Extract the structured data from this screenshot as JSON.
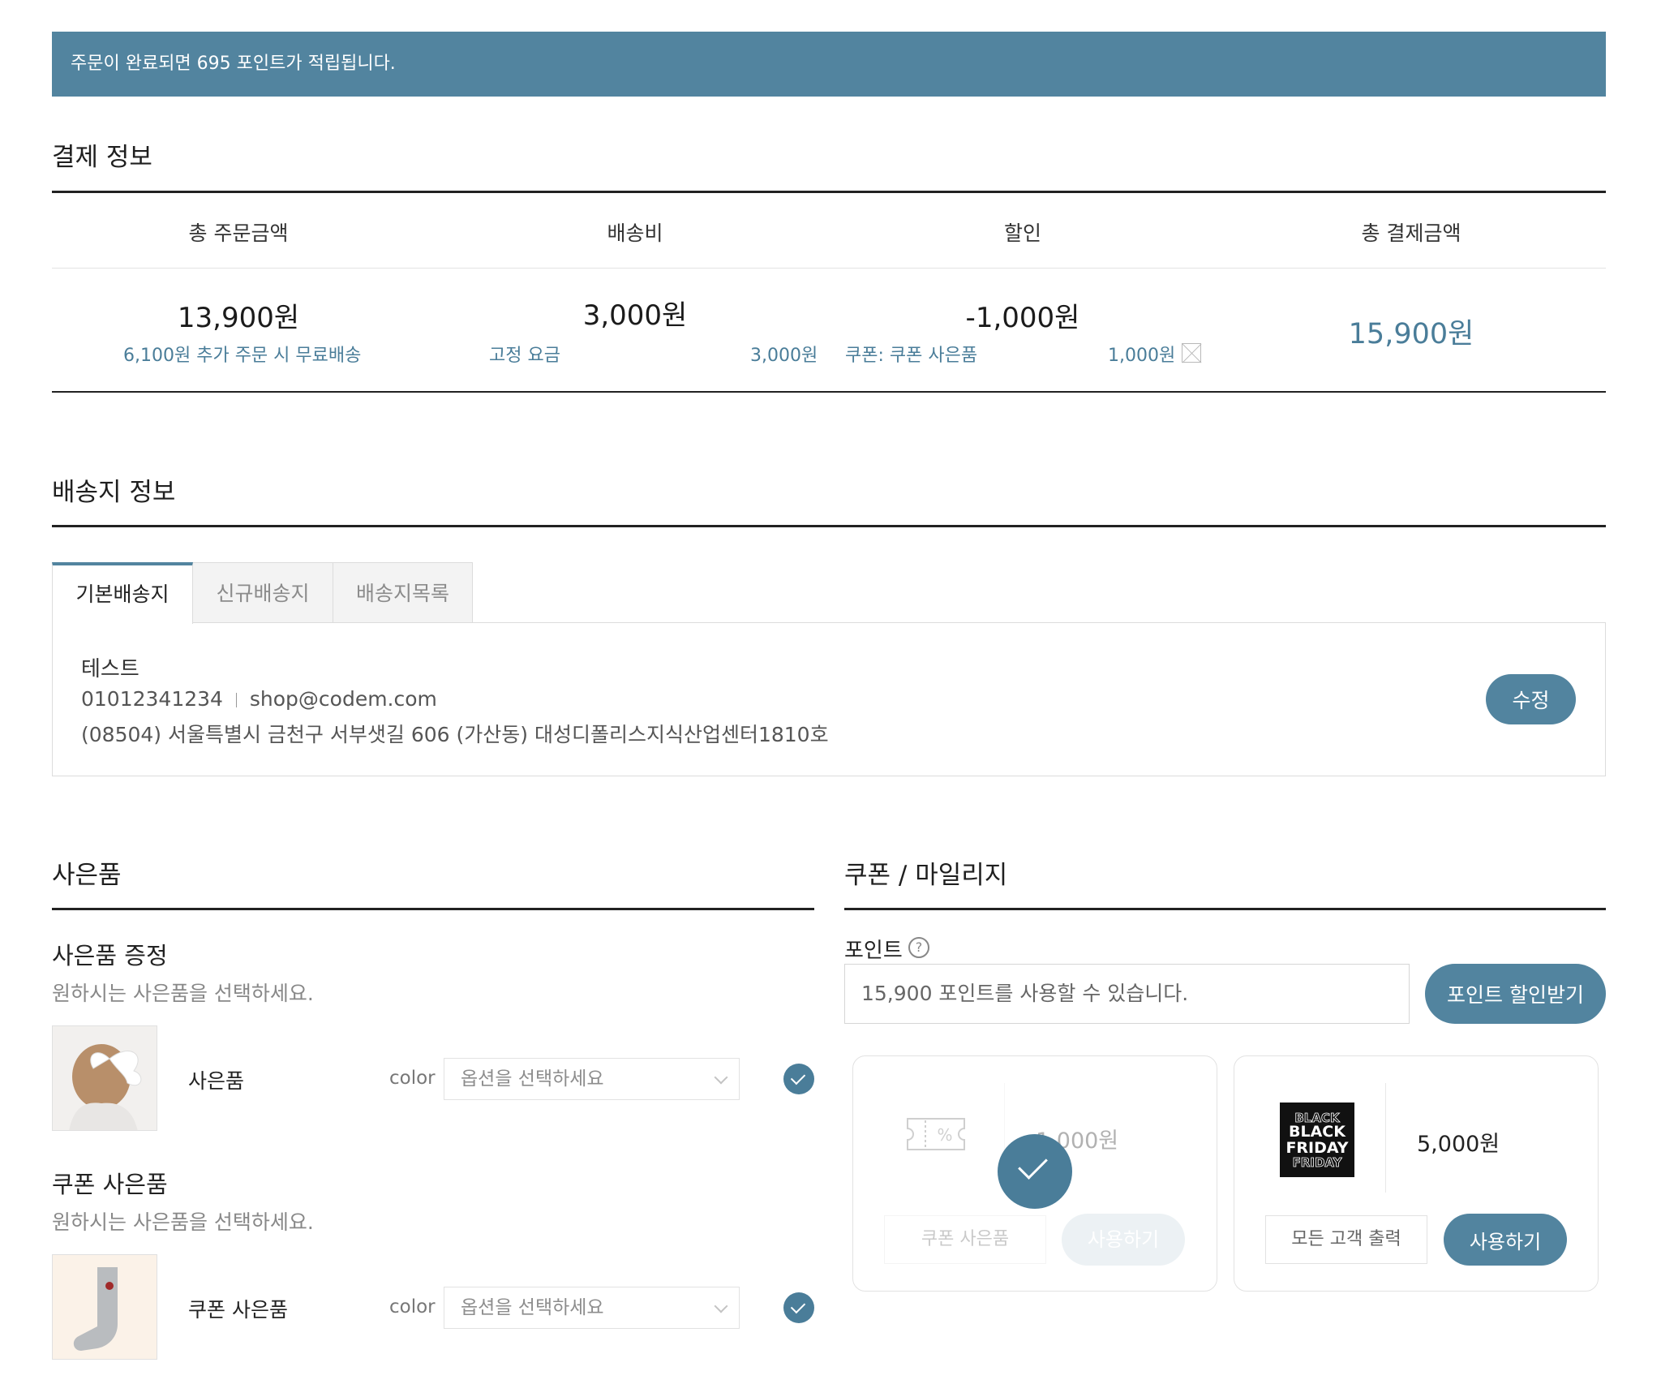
{
  "banner": {
    "text": "주문이 완료되면 695 포인트가 적립됩니다."
  },
  "payment": {
    "title": "결제 정보",
    "headers": [
      "총 주문금액",
      "배송비",
      "할인",
      "총 결제금액"
    ],
    "order_total": "13,900원",
    "order_sub": "6,100원 추가 주문 시 무료배송",
    "shipping": "3,000원",
    "shipping_sub_label": "고정 요금",
    "shipping_sub_value": "3,000원",
    "discount": "-1,000원",
    "discount_sub_label": "쿠폰: 쿠폰 사은품",
    "discount_sub_value": "1,000원",
    "final_total": "15,900원"
  },
  "shipping_info": {
    "title": "배송지 정보",
    "tabs": [
      "기본배송지",
      "신규배송지",
      "배송지목록"
    ],
    "name": "테스트",
    "phone": "01012341234",
    "email": "shop@codem.com",
    "address": "(08504) 서울특별시 금천구 서부샛길 606 (가산동) 대성디폴리스지식산업센터1810호",
    "edit_button": "수정"
  },
  "gifts": {
    "title": "사은품",
    "groups": [
      {
        "title": "사은품 증정",
        "hint": "원하시는 사은품을 선택하세요.",
        "item_name": "사은품",
        "option_label": "color",
        "option_placeholder": "옵션을 선택하세요"
      },
      {
        "title": "쿠폰 사은품",
        "hint": "원하시는 사은품을 선택하세요.",
        "item_name": "쿠폰 사은품",
        "option_label": "color",
        "option_placeholder": "옵션을 선택하세요"
      }
    ]
  },
  "coupons": {
    "title": "쿠폰 / 마일리지",
    "points_label": "포인트",
    "points_help": "?",
    "points_placeholder": "15,900 포인트를 사용할 수 있습니다.",
    "points_button": "포인트 할인받기",
    "cards": [
      {
        "amount": "1,000원",
        "label": "쿠폰 사은품",
        "button": "사용하기",
        "icon": "coupon-percent-icon",
        "selected": true
      },
      {
        "amount": "5,000원",
        "label": "모든 고객 출력",
        "button": "사용하기",
        "image_text": "BLACK FRIDAY",
        "selected": false
      }
    ]
  },
  "colors": {
    "accent": "#52849f",
    "accent_text": "#4a7d99"
  }
}
